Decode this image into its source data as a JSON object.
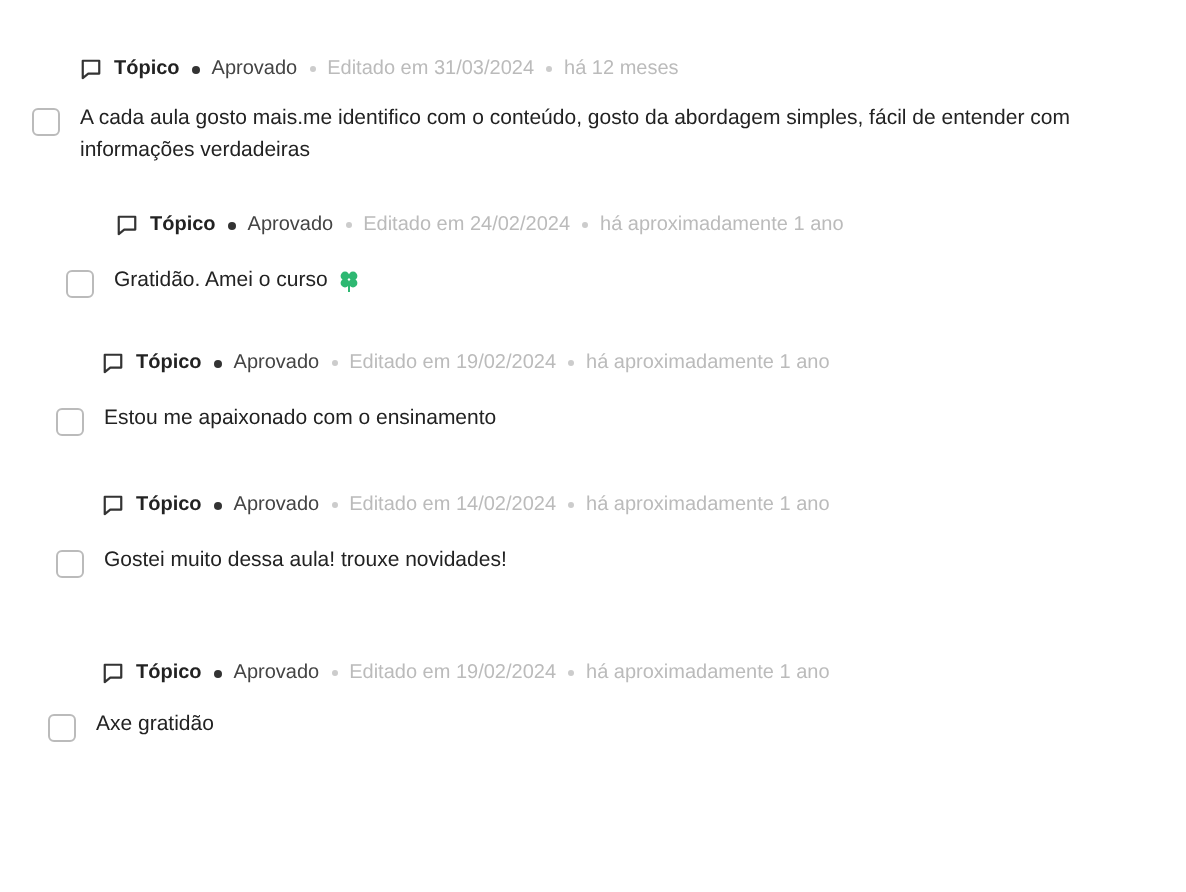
{
  "comments": [
    {
      "type": "Tópico",
      "status": "Aprovado",
      "edited": "Editado em 31/03/2024",
      "age": "há 12 meses",
      "text": "A cada aula gosto mais.me identifico com o conteúdo, gosto da abordagem simples, fácil de entender com informações verdadeiras",
      "checked": false,
      "emoji": false
    },
    {
      "type": "Tópico",
      "status": "Aprovado",
      "edited": "Editado em 24/02/2024",
      "age": "há aproximadamente 1 ano",
      "text": "Gratidão. Amei o curso",
      "checked": false,
      "emoji": true
    },
    {
      "type": "Tópico",
      "status": "Aprovado",
      "edited": "Editado em 19/02/2024",
      "age": "há aproximadamente 1 ano",
      "text": "Estou me apaixonado com o ensinamento",
      "checked": false,
      "emoji": false
    },
    {
      "type": "Tópico",
      "status": "Aprovado",
      "edited": "Editado em 14/02/2024",
      "age": "há aproximadamente 1 ano",
      "text": "Gostei muito dessa aula! trouxe novidades!",
      "checked": false,
      "emoji": false
    },
    {
      "type": "Tópico",
      "status": "Aprovado",
      "edited": "Editado em 19/02/2024",
      "age": "há aproximadamente 1 ano",
      "text": "Axe gratidão",
      "checked": false,
      "emoji": false
    }
  ]
}
